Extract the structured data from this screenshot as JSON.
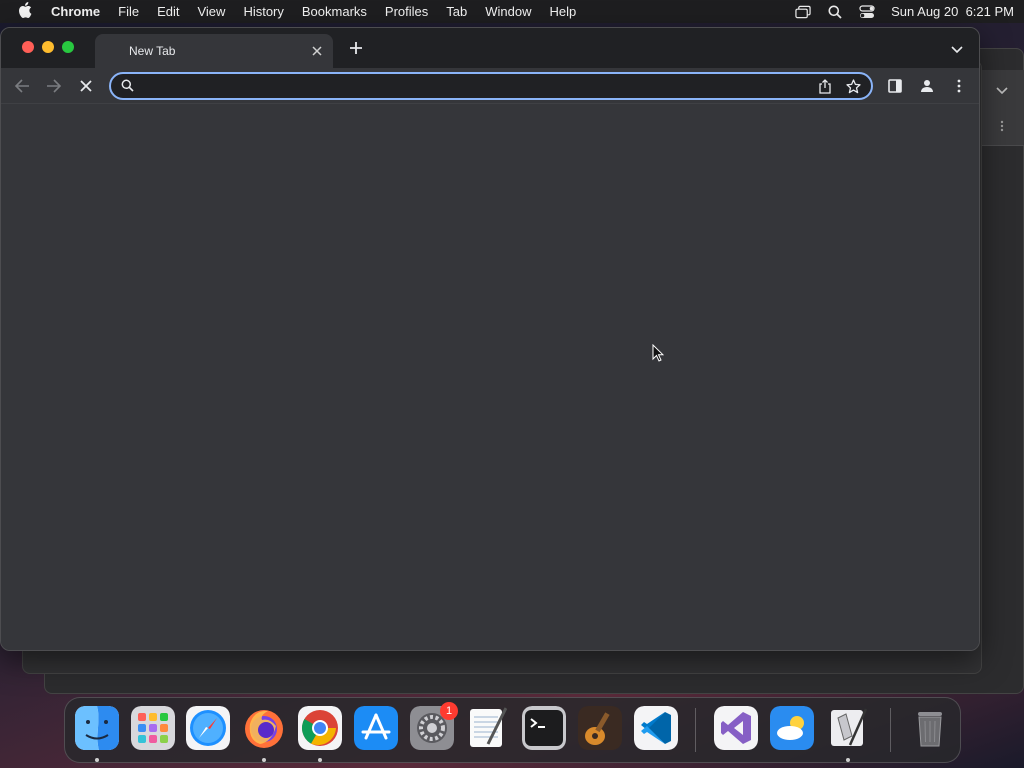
{
  "menubar": {
    "app_name": "Chrome",
    "items": [
      "File",
      "Edit",
      "View",
      "History",
      "Bookmarks",
      "Profiles",
      "Tab",
      "Window",
      "Help"
    ],
    "datetime": "Sun Aug 20  6:21 PM"
  },
  "browser": {
    "tab_title": "New Tab",
    "omnibox_value": "",
    "omnibox_placeholder": "",
    "accent_color": "#8ab4f8"
  },
  "dock": {
    "apps": [
      "finder-icon",
      "launchpad-icon",
      "safari-icon",
      "firefox-icon",
      "chrome-icon",
      "app-store-icon",
      "system-settings-icon",
      "textedit-icon",
      "terminal-icon",
      "garageband-icon",
      "vscode-icon",
      "visual-studio-icon",
      "weather-icon",
      "script-editor-icon",
      "trash-icon"
    ],
    "settings_badge": "1"
  }
}
